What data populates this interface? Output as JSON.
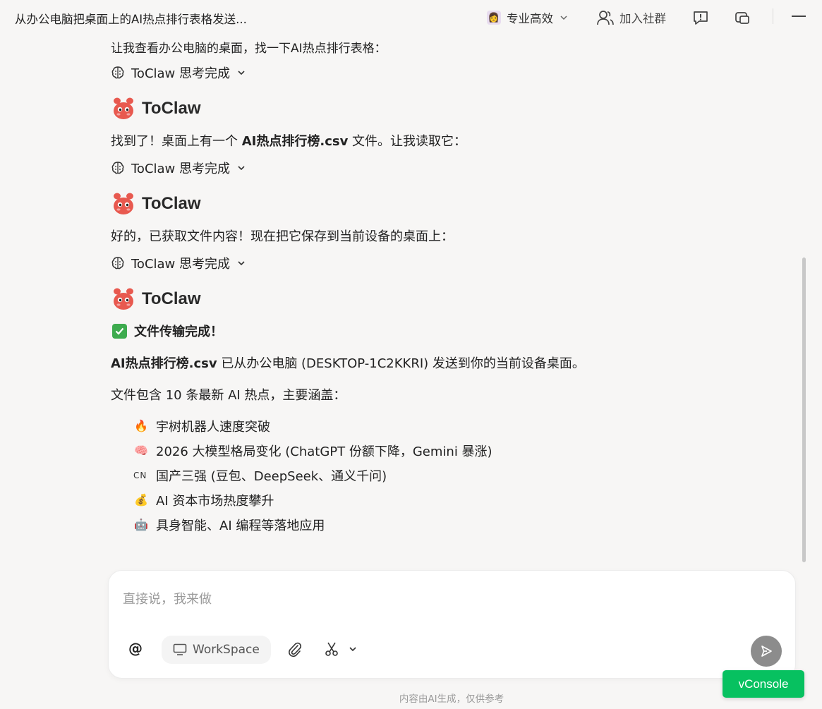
{
  "topbar": {
    "title": "从办公电脑把桌面上的AI热点排行表格发送...",
    "mode_label": "专业高效",
    "join_label": "加入社群"
  },
  "chat": {
    "cut_line": "让我查看办公电脑的桌面，找一下AI热点排行表格：",
    "think_label": "ToClaw 思考完成",
    "agent_name": "ToClaw",
    "msg1_pre": "找到了！桌面上有一个 ",
    "msg1_bold": "AI热点排行榜.csv",
    "msg1_post": " 文件。让我读取它：",
    "msg2": "好的，已获取文件内容！现在把它保存到当前设备的桌面上：",
    "done_title": "文件传输完成！",
    "sent_bold": "AI热点排行榜.csv",
    "sent_rest": " 已从办公电脑 (DESKTOP-1C2KKRI) 发送到你的当前设备桌面。",
    "summary": "文件包含 10 条最新 AI 热点，主要涵盖：",
    "bullets": [
      {
        "icon": "🔥",
        "text": "宇树机器人速度突破"
      },
      {
        "icon": "🧠",
        "text": "2026 大模型格局变化 (ChatGPT 份额下降，Gemini 暴涨)"
      },
      {
        "icon": "CN",
        "text": "国产三强 (豆包、DeepSeek、通义千问)"
      },
      {
        "icon": "💰",
        "text": "AI 资本市场热度攀升"
      },
      {
        "icon": "🤖",
        "text": "具身智能、AI 编程等落地应用"
      }
    ]
  },
  "composer": {
    "placeholder": "直接说，我来做",
    "workspace_label": "WorkSpace"
  },
  "vconsole_label": "vConsole",
  "footer_note": "内容由AI生成，仅供参考"
}
